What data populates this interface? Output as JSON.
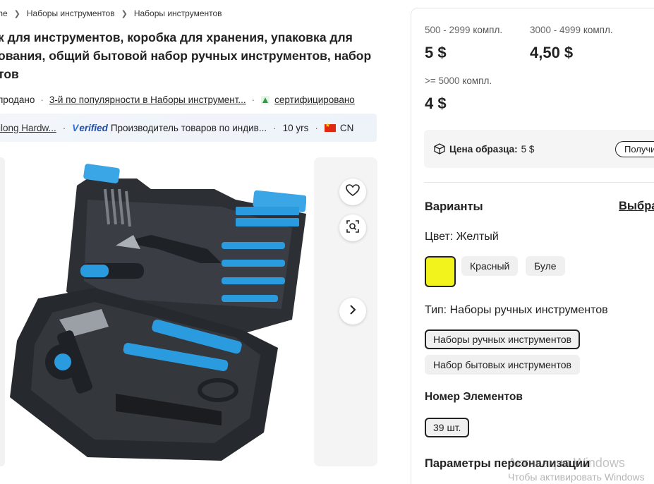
{
  "breadcrumb": {
    "items": [
      "me",
      "Наборы инструментов",
      "Наборы инструментов"
    ]
  },
  "product": {
    "title_lines": [
      "к для инструментов, коробка для хранения, упаковка для",
      "ования, общий бытовой набор ручных инструментов, набор",
      "тов"
    ],
    "sold": "продано",
    "popularity": "3-й по популярности в Наборы инструмент...",
    "certified": "сертифицировано"
  },
  "supplier": {
    "name": "ilong Hardw...",
    "verified_label": "erified",
    "verified_mark": "V",
    "description": "Производитель товаров по индив...",
    "years": "10 yrs",
    "country": "CN"
  },
  "pricing": {
    "tiers": [
      {
        "range": "500 - 2999",
        "unit": "компл.",
        "price": "5 $"
      },
      {
        "range": "3000 - 4999",
        "unit": "компл.",
        "price": "4,50 $"
      },
      {
        "range": ">= 5000",
        "unit": "компл.",
        "price": "4 $"
      }
    ],
    "sample_label": "Цена образца:",
    "sample_price": "5 $",
    "get_sample": "Получи"
  },
  "variants": {
    "heading": "Варианты",
    "select_link": "Выбра",
    "color_label": "Цвет: Желтый",
    "selected_color": "#f2f21c",
    "colors": [
      "Красный",
      "Буле"
    ],
    "type_label": "Тип: Наборы ручных инструментов",
    "types": [
      "Наборы ручных инструментов",
      "Набор бытовых инструментов"
    ],
    "count_label": "Номер Элементов",
    "counts": [
      "39 шт."
    ],
    "customization_label": "Параметры персонализации"
  },
  "watermark": {
    "line1": "Активация Windows",
    "line2": "Чтобы активировать Windows"
  },
  "icons": [
    "chevron-right-icon",
    "certified-icon",
    "heart-icon",
    "image-search-icon",
    "arrow-right-icon",
    "package-icon",
    "flag-cn-icon"
  ],
  "colors": {
    "accent_blue": "#2b9be0",
    "text": "#222222",
    "selected_swatch": "#f2f21c"
  }
}
